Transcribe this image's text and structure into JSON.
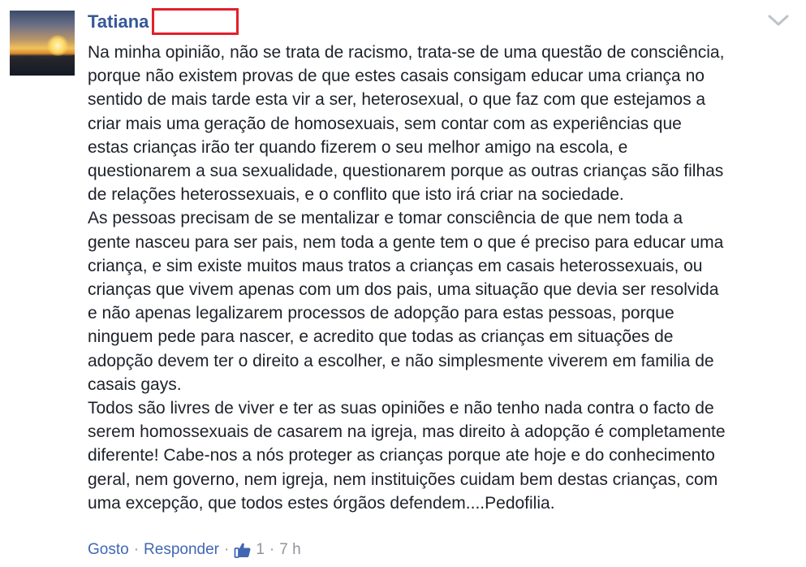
{
  "comment": {
    "author": "Tatiana",
    "paragraphs": [
      "Na minha opinião, não se trata de racismo, trata-se de uma questão de consciência,\nporque não existem provas de que estes casais consigam educar uma criança no\nsentido de mais tarde esta vir a ser, heterosexual, o que faz com que estejamos a\ncriar mais uma geração de homosexuais, sem contar com as experiências que\nestas crianças irão ter quando fizerem o seu melhor amigo na escola, e\nquestionarem a sua sexualidade, questionarem porque as outras crianças são filhas\nde relações heterossexuais, e o conflito que isto irá criar na sociedade.",
      "As pessoas precisam de se mentalizar e tomar consciência de que nem toda a\ngente nasceu para ser pais, nem toda a gente tem o que é preciso para educar uma\ncriança, e sim existe muitos maus tratos a crianças em casais heterossexuais, ou\ncrianças que vivem apenas com um dos pais, uma situação que devia ser resolvida\ne não apenas legalizarem processos de adopção para estas pessoas, porque\nninguem pede para nascer, e acredito que todas as crianças em situações de\nadopção devem ter o direito a escolher, e não simplesmente viverem em familia de\ncasais gays.",
      "Todos são livres de viver e ter as suas opiniões e não tenho nada contra o facto de\nserem homossexuais de casarem na igreja, mas direito à adopção é completamente\ndiferente! Cabe-nos a nós proteger as crianças porque ate hoje e do conhecimento\ngeral, nem governo, nem igreja, nem instituições cuidam bem destas crianças, com\numa excepção, que todos estes órgãos defendem....Pedofilia."
    ],
    "actions": {
      "like_label": "Gosto",
      "reply_label": "Responder",
      "separator": "·",
      "like_count": "1",
      "time_ago": "7 h"
    }
  },
  "icons": {
    "options": "chevron-down-icon",
    "like": "thumbs-up-icon"
  },
  "colors": {
    "author": "#365899",
    "link": "#4267b2",
    "meta": "#90949c",
    "text": "#1d2129",
    "redaction_border": "#e2202c"
  }
}
